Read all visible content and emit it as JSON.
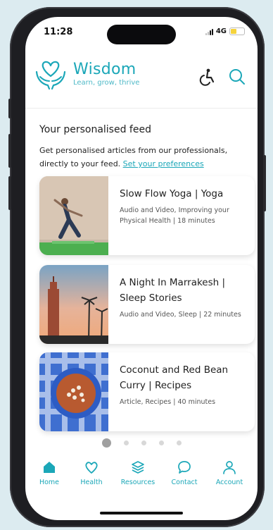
{
  "colors": {
    "accent": "#1ba7b8",
    "background": "#dcebf0"
  },
  "status_bar": {
    "time": "11:28",
    "network": "4G"
  },
  "header": {
    "brand_name": "Wisdom",
    "tagline": "Learn, grow, thrive",
    "icons": [
      "heart-hands-logo-icon",
      "accessibility-icon",
      "search-icon"
    ]
  },
  "feed": {
    "title": "Your personalised feed",
    "description": "Get personalised articles from our professionals, directly to your feed.",
    "preferences_link": "Set your preferences",
    "cards": [
      {
        "title": "Slow Flow Yoga | Yoga",
        "meta": "Audio and Video, Improving your Physical Health | 18 minutes"
      },
      {
        "title": "A Night In Marrakesh | Sleep Stories",
        "meta": "Audio and Video, Sleep | 22 minutes"
      },
      {
        "title": "Coconut and Red Bean Curry | Recipes",
        "meta": "Article, Recipes | 40 minutes"
      }
    ],
    "pagination": {
      "total": 5,
      "active": 1
    }
  },
  "tabbar": {
    "tabs": [
      {
        "label": "Home",
        "icon": "home-icon"
      },
      {
        "label": "Health",
        "icon": "heart-icon"
      },
      {
        "label": "Resources",
        "icon": "layers-icon"
      },
      {
        "label": "Contact",
        "icon": "chat-bubble-icon"
      },
      {
        "label": "Account",
        "icon": "person-icon"
      }
    ]
  }
}
